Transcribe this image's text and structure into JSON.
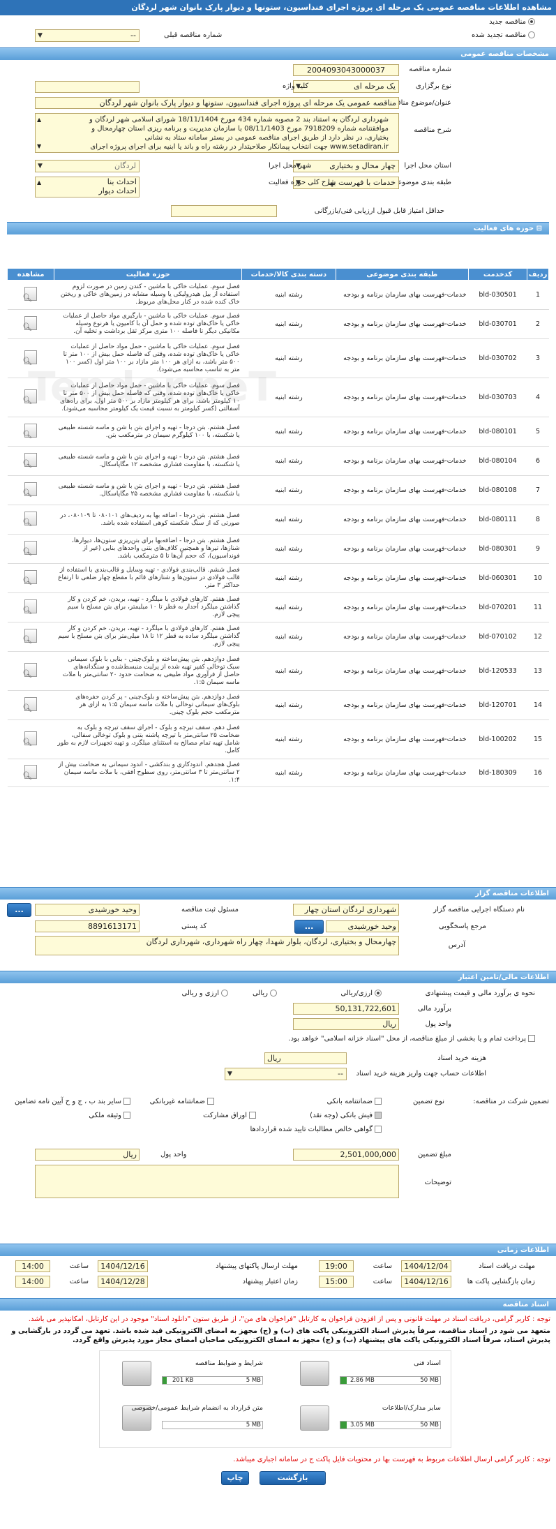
{
  "header": {
    "title": "مشاهده اطلاعات مناقصه عمومی یک مرحله ای پروژه اجرای فنداسیون، ستونها و دیوار پارک بانوان شهر لردگان"
  },
  "top": {
    "radio_new": "مناقصه جدید",
    "radio_renew": "مناقصه تجدید شده",
    "prev_label": "شماره مناقصه قبلی",
    "prev_value": "--"
  },
  "general": {
    "section_title": "مشخصات مناقصه عمومی",
    "number_label": "شماره مناقصه",
    "number_value": "2004093043000037",
    "type_label": "نوع برگزاری",
    "type_value": "یک مرحله ای",
    "keyword_label": "کلید واژه",
    "keyword_value": "",
    "subject_label": "عنوان/موضوع مناقصه",
    "subject_value": "مناقصه عمومی یک مرحله ای  پروژه اجرای فنداسیون، ستونها و دیوار پارک بانوان شهر لردگان",
    "desc_label": "شرح مناقصه",
    "desc_lines": [
      "شهرداری لردگان به استناد بند 2 مصوبه شماره 434 مورخ 18/11/1404 شورای اسلامی شهر لردگان و",
      "موافقتنامه شماره 7918209 مورخ 08/11/1403 با سازمان مدیریت و برنامه ریزی استان چهارمحال و",
      "بختیاری، در نظر دارد از طریق اجرای مناقصه عمومی در بستر سامانه ستاد به نشانی",
      "www.setadiran.ir جهت انتخاب پیمانکار صلاحیتدار در رشته راه و باند یا ابنیه برای اجرای پروژه اجرای"
    ],
    "province_label": "استان محل اجرا",
    "province_value": "چهار محال و بختیاری",
    "city_label": "شهر محل اجرا",
    "city_value": "لردگان",
    "category_label": "طبقه بندی موضوعی",
    "category_value": "خدمات با فهرست بها",
    "field_label": "شرح کلی حوزه فعالیت",
    "field_lines": [
      "احداث بنا",
      "احداث دیوار"
    ],
    "min_score_label": "حداقل امتیاز قابل قبول ارزیابی فنی/بازرگانی",
    "min_score_value": ""
  },
  "activities": {
    "section_title": "حوزه های فعالیت",
    "columns": {
      "row": "ردیف",
      "code": "کدخدمت",
      "category": "طبقه بندی موضوعی",
      "group": "دسته بندی کالا/خدمات",
      "activity": "حوزه فعالیت",
      "view": "مشاهده"
    },
    "rows": [
      {
        "n": "1",
        "code": "bld-030501",
        "cat": "خدمات-فهرست بهای سازمان برنامه و بودجه",
        "grp": "رشته ابنیه",
        "desc": "فصل سوم. عملیات خاکی با ماشین - کندن زمین در صورت لزوم استفاده از بیل هیدرولیکی یا وسیله مشابه در زمین‌های خاکی و ریختن خاک کنده شده در کنار محل‌های مربوط."
      },
      {
        "n": "2",
        "code": "bld-030701",
        "cat": "خدمات-فهرست بهای سازمان برنامه و بودجه",
        "grp": "رشته ابنیه",
        "desc": "فصل سوم. عملیات خاکی با ماشین - بارگیری مواد حاصل از عملیات خاکی یا خاک‌های توده شده و حمل آن با کامیون یا هرنوع وسیله مکانیکی دیگر تا فاصله ۱۰۰ متری مرکز ثقل برداشت و تخلیه آن."
      },
      {
        "n": "3",
        "code": "bld-030702",
        "cat": "خدمات-فهرست بهای سازمان برنامه و بودجه",
        "grp": "رشته ابنیه",
        "desc": "فصل سوم. عملیات خاکی با ماشین - حمل مواد حاصل از عملیات خاکی یا خاک‌های توده شده، وقتی که فاصله حمل بیش از ۱۰۰ متر تا ۵۰۰ متر باشد، به ازای هر ۱۰۰ متر مازاد بر ۱۰۰ متر اول (کسر ۱۰۰ متر به تناسب محاسبه می‌شود)."
      },
      {
        "n": "4",
        "code": "bld-030703",
        "cat": "خدمات-فهرست بهای سازمان برنامه و بودجه",
        "grp": "رشته ابنیه",
        "desc": "فصل سوم. عملیات خاکی با ماشین - حمل مواد حاصل از عملیات خاکی یا خاک‌های توده شده، وقتی که فاصله حمل بیش از ۵۰۰ متر تا ۱۰ کیلومتر باشد، برای هر کیلومتر مازاد بر ۵۰۰ متر اول، برای راه‌های آسفالتی (کسر کیلومتر به نسبت قیمت یک کیلومتر محاسبه می‌شود)."
      },
      {
        "n": "5",
        "code": "bld-080101",
        "cat": "خدمات-فهرست بهای سازمان برنامه و بودجه",
        "grp": "رشته ابنیه",
        "desc": "فصل هشتم. بتن درجا - تهیه و اجرای بتن با شن و ماسه شسته طبیعی یا شکسته، با ۱۰۰ کیلوگرم سیمان در مترمکعب بتن."
      },
      {
        "n": "6",
        "code": "bld-080104",
        "cat": "خدمات-فهرست بهای سازمان برنامه و بودجه",
        "grp": "رشته ابنیه",
        "desc": "فصل هشتم. بتن درجا - تهیه و اجرای بتن با شن و ماسه شسته طبیعی یا شکسته، با مقاومت فشاری مشخصه ۱۲ مگاپاسکال."
      },
      {
        "n": "7",
        "code": "bld-080108",
        "cat": "خدمات-فهرست بهای سازمان برنامه و بودجه",
        "grp": "رشته ابنیه",
        "desc": "فصل هشتم. بتن درجا - تهیه و اجرای بتن با شن و ماسه شسته طبیعی یا شکسته، با مقاومت فشاری مشخصه ۲۵ مگاپاسکال."
      },
      {
        "n": "8",
        "code": "bld-080111",
        "cat": "خدمات-فهرست بهای سازمان برنامه و بودجه",
        "grp": "رشته ابنیه",
        "desc": "فصل هشتم. بتن درجا - اضافه بها به ردیف‌های ۰۸۰۱۰۱ تا ۰۸۰۱۰۹، در صورتی که از سنگ شکسته کوهی استفاده شده باشد."
      },
      {
        "n": "9",
        "code": "bld-080301",
        "cat": "خدمات-فهرست بهای سازمان برنامه و بودجه",
        "grp": "رشته ابنیه",
        "desc": "فصل هشتم. بتن درجا - اضافه‌بها برای بتن‌ریزی ستون‌ها، دیوارها، شنازها، تیرها و همچنین کلاف‌های بتنی واحدهای بنایی (غیر از فونداسیون)، که حجم آن‌ها تا ۵ مترمکعب باشد."
      },
      {
        "n": "10",
        "code": "bld-060301",
        "cat": "خدمات-فهرست بهای سازمان برنامه و بودجه",
        "grp": "رشته ابنیه",
        "desc": "فصل ششم. قالب‌بندی فولادی - تهیه وسایل و قالب‌بندی با استفاده از قالب فولادی در ستون‌ها و شنازهای قائم با مقطع چهار ضلعی تا ارتفاع حداکثر ۳ متر."
      },
      {
        "n": "11",
        "code": "bld-070201",
        "cat": "خدمات-فهرست بهای سازمان برنامه و بودجه",
        "grp": "رشته ابنیه",
        "desc": "فصل هفتم. کارهای فولادی با میلگرد - تهیه، بریدن، خم کردن و کار گذاشتن میلگرد آجدار به قطر تا ۱۰ میلیمتر، برای بتن مسلح با سیم پیچی لازم."
      },
      {
        "n": "12",
        "code": "bld-070102",
        "cat": "خدمات-فهرست بهای سازمان برنامه و بودجه",
        "grp": "رشته ابنیه",
        "desc": "فصل هفتم. کارهای فولادی با میلگرد - تهیه، بریدن، خم کردن و کار گذاشتن میلگرد ساده به قطر ۱۲ تا ۱۸ میلی‌متر برای بتن مسلح با سیم پیچی لازم."
      },
      {
        "n": "13",
        "code": "bld-120533",
        "cat": "خدمات-فهرست بهای سازمان برنامه و بودجه",
        "grp": "رشته ابنیه",
        "desc": "فصل دوازدهم. بتن پیش‌ساخته و بلوک‌چینی - بنایی با بلوک سیمانی سبک توخالی کفپر تهیه شده از پرلیت منبسط‌شده و سنگدانه‌های حاصل از فرآوری مواد طبیعی به ضخامت حدود ۲۰ سانتی‌متر با ملات ماسه سیمان ۱:۵."
      },
      {
        "n": "14",
        "code": "bld-120701",
        "cat": "خدمات-فهرست بهای سازمان برنامه و بودجه",
        "grp": "رشته ابنیه",
        "desc": "فصل دوازدهم. بتن پیش‌ساخته و بلوک‌چینی - پر کردن حفره‌های بلوک‌های سیمانی توخالی با ملات ماسه سیمان ۱:۵ به ازای هر مترمکعب حجم بلوک چینی."
      },
      {
        "n": "15",
        "code": "bld-100202",
        "cat": "خدمات-فهرست بهای سازمان برنامه و بودجه",
        "grp": "رشته ابنیه",
        "desc": "فصل دهم. سقف تیرچه و بلوک - اجرای سقف تیرچه و بلوک به ضخامت ۲۵ سانتی‌متر با تیرچه پاشنه بتنی و بلوک توخالی سفالی، شامل تهیه تمام مصالح به استثنای میلگرد، و تهیه تجهیزات لازم به طور کامل."
      },
      {
        "n": "16",
        "code": "bld-180309",
        "cat": "خدمات-فهرست بهای سازمان برنامه و بودجه",
        "grp": "رشته ابنیه",
        "desc": "فصل هجدهم. اندودکاری و بندکشی - اندود سیمانی به ضخامت بیش از ۲ سانتی‌متر تا ۳ سانتی‌متر، روی سطوح افقی، با ملات ماسه سیمان ۱:۴."
      }
    ]
  },
  "organizer": {
    "section_title": "اطلاعات مناقصه گزار",
    "org_label": "نام دستگاه اجرایی مناقصه گزار",
    "org_value": "شهرداری لردگان استان چهار",
    "resp_label": "مسئول ثبت مناقصه",
    "resp_value": "وحید خورشیدی",
    "ref_label": "مرجع پاسخگویی",
    "ref_value": "وحید خورشیدی",
    "postal_label": "کد پستی",
    "postal_value": "8891613171",
    "address_label": "آدرس",
    "address_value": "چهارمحال و بختیاری، لردگان، بلوار شهدا، چهار راه شهرداری، شهرداری لردگان",
    "dots": "..."
  },
  "finance": {
    "section_title": "اطلاعات مالی/تامین اعتبار",
    "currency_type_label": "نحوه ی برآورد مالی و قیمت پیشنهادی",
    "rial_label": "ارزی/ریالی",
    "rial_only": "ریالی",
    "foreign": "ارزی و ریالی",
    "estimate_label": "برآورد مالی",
    "estimate_value": "50,131,722,601",
    "unit_label": "واحد پول",
    "unit_value": "ریال",
    "treasury_text": "پرداخت تمام و یا بخشی از مبلغ مناقصه، از محل \"اسناد خزانه اسلامی\" خواهد بود.",
    "doc_cost_label": "هزینه خرید اسناد",
    "doc_cost_unit": "ریال",
    "account_label": "اطلاعات حساب جهت واریز هزینه خرید اسناد",
    "account_value": "--",
    "guarantee_label": "تضمین شرکت در مناقصه:",
    "guarantee_type_label": "نوع تضمین",
    "g1": "ضمانتنامه بانکی",
    "g2": "ضمانتنامه غیربانکی",
    "g3": "وثیقه ملکی",
    "g4": "فیش بانکی (وجه نقد)",
    "g5": "اوراق مشارکت",
    "g6": "گواهی خالص مطالبات تایید شده قراردادها",
    "g7": "سایر بند ب ، ج و ح آیین نامه تضامین",
    "amount_label": "مبلغ تضمین",
    "amount_value": "2,501,000,000",
    "amount_unit_label": "واحد پول",
    "amount_unit_value": "ریال",
    "notes_label": "توضیحات"
  },
  "timing": {
    "section_title": "اطلاعات زمانی",
    "receive_label": "مهلت دریافت اسناد",
    "receive_date": "1404/12/04",
    "receive_time": "19:00",
    "hour_label": "ساعت",
    "submit_label": "مهلت ارسال پاکتهای پیشنهاد",
    "submit_date": "1404/12/16",
    "submit_time": "14:00",
    "open_label": "زمان بازگشایی پاکت ها",
    "open_date": "1404/12/16",
    "open_time": "15:00",
    "validity_label": "زمان اعتبار پیشنهاد",
    "validity_date": "1404/12/28",
    "validity_time": "14:00"
  },
  "documents": {
    "section_title": "اسناد مناقصه",
    "note1": "توجه : کاربر گرامی، دریافت اسناد در مهلت قانونی و پس از افزودن فراخوان به کارتابل \"فراخوان های من\"، از طریق ستون \"دانلود اسناد\" موجود در این کارتابل، امکانپذیر می باشد.",
    "note2": "متعهد می شود در اسناد مناقصه، صرفاً پذیرش اسناد الکترونیکی پاکت های (ب) و (ج) مجهز به امضای الکترونیکی قید شده باشد. تعهد می گردد در بارگشایی و پذیرش اسناد، صرفاً اسناد الکترونیکی پاکت های پیشنهاد (ب) و (ج) مجهز به امضای الکترونیکی صاحبان امضای مجاز مورد پذیرش واقع گردد.",
    "files": [
      {
        "name": "شرایط و ضوابط مناقصه",
        "used": "201 KB",
        "cap": "5 MB",
        "fill": 0.04
      },
      {
        "name": "اسناد فنی",
        "used": "2.86 MB",
        "cap": "50 MB",
        "fill": 0.06
      },
      {
        "name": "متن قرارداد به انضمام شرایط عمومی/خصوصی",
        "used": "",
        "cap": "5 MB",
        "fill": 0.0
      },
      {
        "name": "سایر مدارک/اطلاعات",
        "used": "3.05 MB",
        "cap": "50 MB",
        "fill": 0.06
      }
    ],
    "note3": "توجه : کاربر گرامی ارسال اطلاعات مربوط به فهرست بها در محتویات فایل پاکت ج در سامانه اجباری میباشد."
  },
  "footer": {
    "print": "چاپ",
    "back": "بازگشت"
  },
  "watermark": "Tender.neT"
}
